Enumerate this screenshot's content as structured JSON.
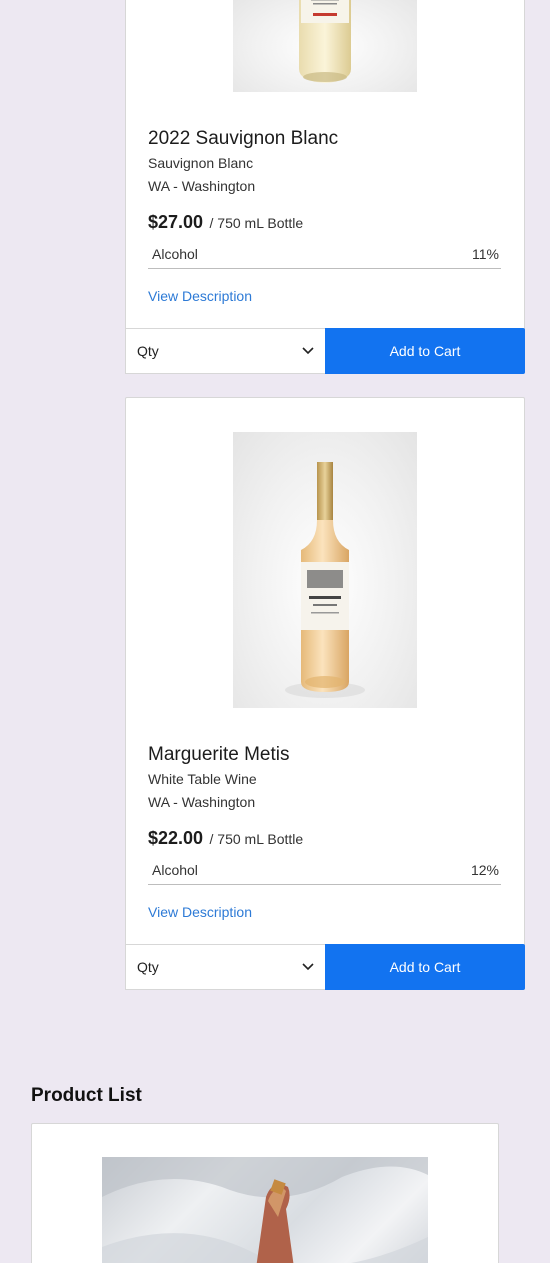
{
  "products": [
    {
      "name": "2022 Sauvignon Blanc",
      "variety": "Sauvignon Blanc",
      "region": "WA - Washington",
      "price": "$27.00",
      "unit": "/ 750 mL Bottle",
      "stat_label": "Alcohol",
      "stat_value": "11%",
      "view_description": "View Description",
      "qty_label": "Qty",
      "add_to_cart": "Add to Cart"
    },
    {
      "name": "Marguerite Metis",
      "variety": "White Table Wine",
      "region": "WA - Washington",
      "price": "$22.00",
      "unit": "/ 750 mL Bottle",
      "stat_label": "Alcohol",
      "stat_value": "12%",
      "view_description": "View Description",
      "qty_label": "Qty",
      "add_to_cart": "Add to Cart"
    }
  ],
  "product_list": {
    "title": "Product List"
  },
  "colors": {
    "background": "#ede8f2",
    "accent": "#1273f0",
    "link": "#2d7ad6"
  }
}
